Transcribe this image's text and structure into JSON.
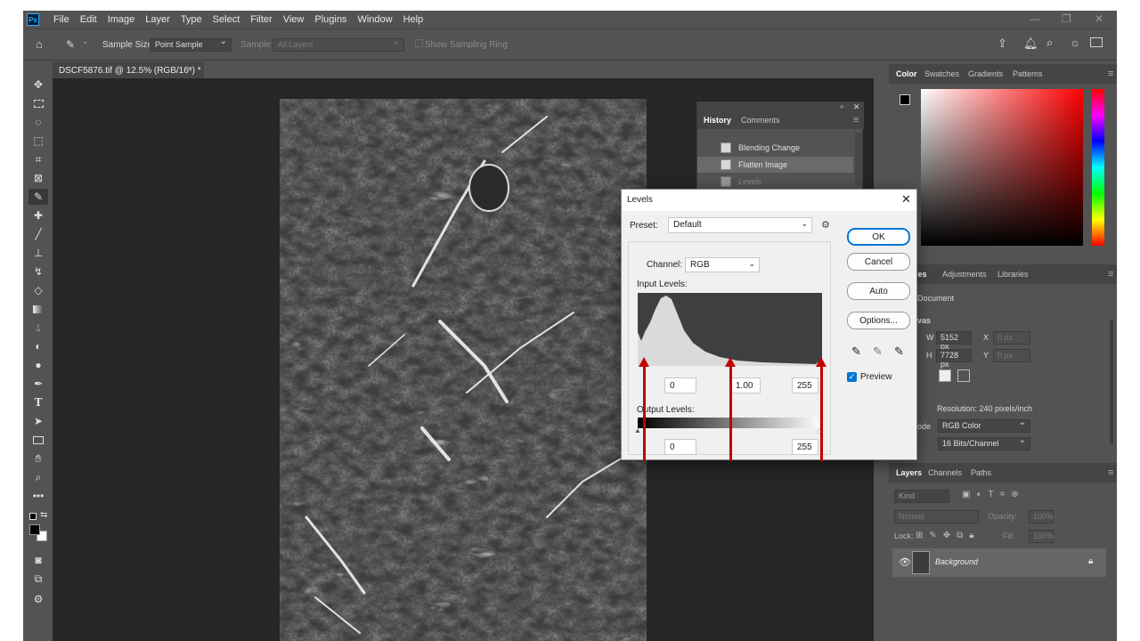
{
  "menu": {
    "logo": "Ps",
    "items": [
      "File",
      "Edit",
      "Image",
      "Layer",
      "Type",
      "Select",
      "Filter",
      "View",
      "Plugins",
      "Window",
      "Help"
    ]
  },
  "options_bar": {
    "sample_size_label": "Sample Size:",
    "sample_size_value": "Point Sample",
    "sample_label": "Sample:",
    "sample_value": "All Layers",
    "show_ring_label": "Show Sampling Ring"
  },
  "document_tab": {
    "title": "DSCF5876.tif @ 12.5% (RGB/16*) *",
    "close": "×"
  },
  "history": {
    "tabs": [
      "History",
      "Comments"
    ],
    "rows": [
      "Blending Change",
      "Flatten Image",
      "Levels"
    ]
  },
  "levels": {
    "title": "Levels",
    "preset_label": "Preset:",
    "preset_value": "Default",
    "channel_label": "Channel:",
    "channel_value": "RGB",
    "input_levels_label": "Input Levels:",
    "input_black": "0",
    "input_gamma": "1.00",
    "input_white": "255",
    "output_levels_label": "Output Levels:",
    "output_black": "0",
    "output_white": "255",
    "ok": "OK",
    "cancel": "Cancel",
    "auto": "Auto",
    "options": "Options...",
    "preview_label": "Preview"
  },
  "color_panel": {
    "tabs": [
      "Color",
      "Swatches",
      "Gradients",
      "Patterns"
    ]
  },
  "properties": {
    "tabs": [
      "ies",
      "Adjustments",
      "Libraries"
    ],
    "doc_label": "Document",
    "canvas_label": "vas",
    "w_label": "W",
    "w_value": "5152 px",
    "h_label": "H",
    "h_value": "7728 px",
    "x_label": "X",
    "x_value": "0 px",
    "y_label": "Y",
    "y_value": "0 px",
    "resolution": "Resolution: 240 pixels/inch",
    "mode_label": "ode",
    "mode_value": "RGB Color",
    "depth_value": "16 Bits/Channel"
  },
  "layers": {
    "tabs": [
      "Layers",
      "Channels",
      "Paths"
    ],
    "kind_placeholder": "Kind",
    "blend_mode": "Normal",
    "opacity_label": "Opacity:",
    "opacity_value": "100%",
    "lock_label": "Lock:",
    "fill_label": "Fill:",
    "fill_value": "100%",
    "layer_name": "Background"
  }
}
